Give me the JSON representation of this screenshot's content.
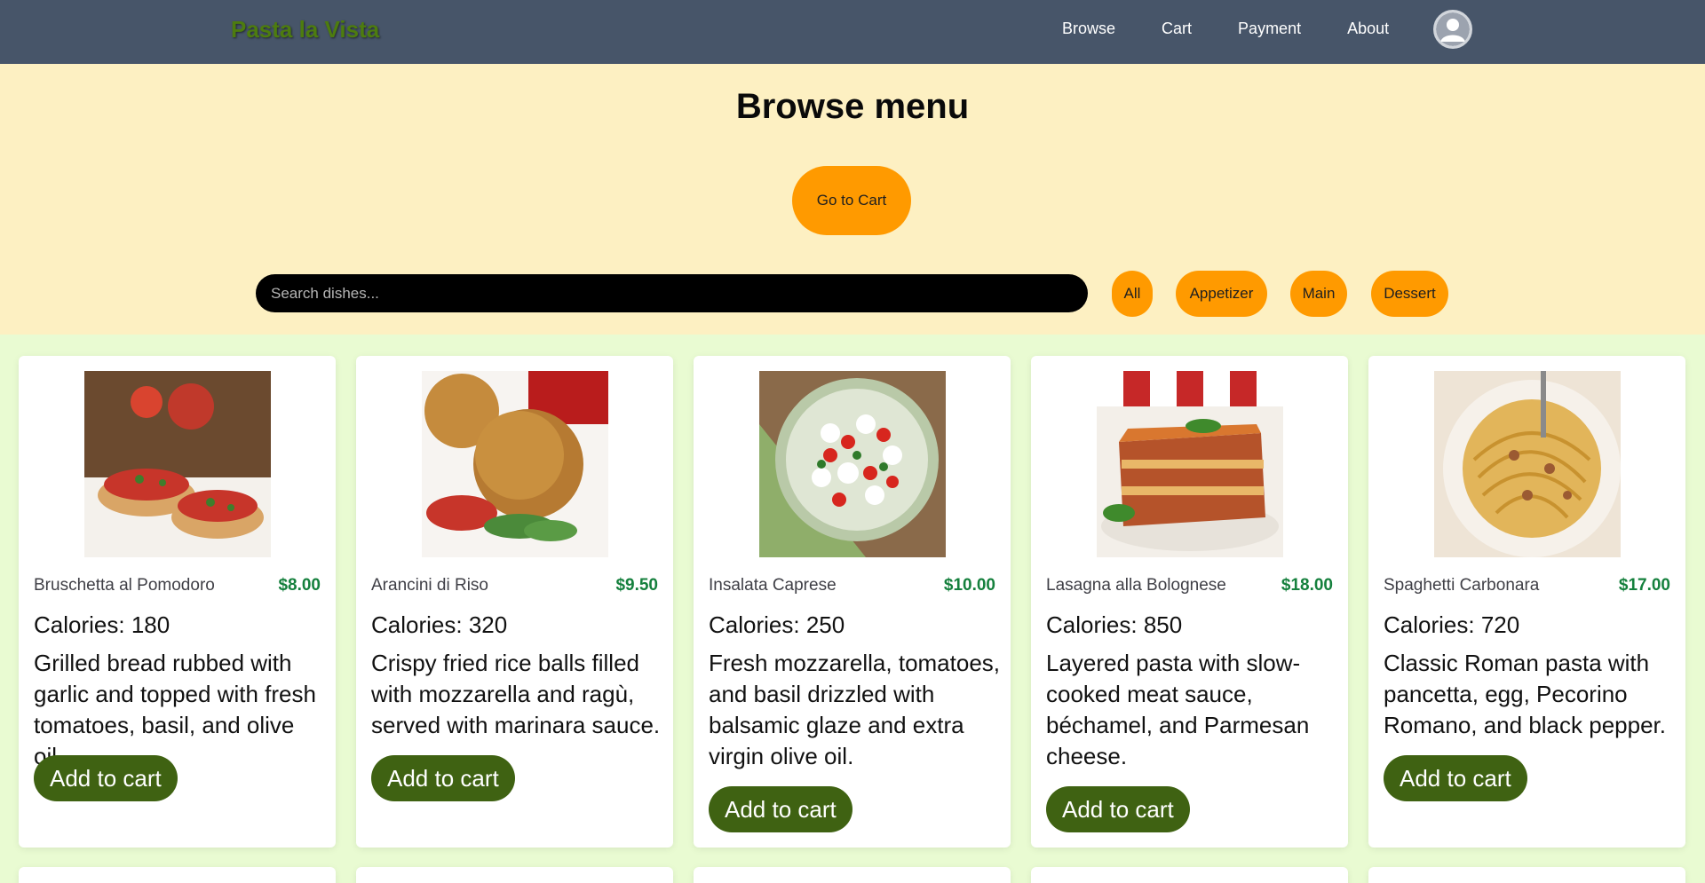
{
  "nav": {
    "brand": "Pasta la Vista",
    "links": [
      "Browse",
      "Cart",
      "Payment",
      "About"
    ],
    "avatar_icon": "user-avatar-icon"
  },
  "hero": {
    "title": "Browse menu",
    "go_cart_label": "Go to Cart",
    "search_placeholder": "Search dishes...",
    "search_value": "",
    "filters": [
      "All",
      "Appetizer",
      "Main",
      "Dessert"
    ]
  },
  "colors": {
    "navbar": "#475569",
    "brand": "#4d7c0f",
    "hero_bg": "#fdf0c2",
    "page_bg": "#e9fbd2",
    "accent_orange": "#ff9a00",
    "price_green": "#15803d",
    "button_green": "#3f6212"
  },
  "dishes": [
    {
      "name": "Bruschetta al Pomodoro",
      "price": "$8.00",
      "calories": "Calories: 180",
      "description": "Grilled bread rubbed with garlic and topped with fresh tomatoes, basil, and olive oil.",
      "add_label": "Add to cart",
      "image": "bruschetta-photo"
    },
    {
      "name": "Arancini di Riso",
      "price": "$9.50",
      "calories": "Calories: 320",
      "description": "Crispy fried rice balls filled with mozzarella and ragù, served with marinara sauce.",
      "add_label": "Add to cart",
      "image": "arancini-photo"
    },
    {
      "name": "Insalata Caprese",
      "price": "$10.00",
      "calories": "Calories: 250",
      "description": "Fresh mozzarella, tomatoes, and basil drizzled with balsamic glaze and extra virgin olive oil.",
      "add_label": "Add to cart",
      "image": "caprese-photo"
    },
    {
      "name": "Lasagna alla Bolognese",
      "price": "$18.00",
      "calories": "Calories: 850",
      "description": "Layered pasta with slow-cooked meat sauce, béchamel, and Parmesan cheese.",
      "add_label": "Add to cart",
      "image": "lasagna-photo"
    },
    {
      "name": "Spaghetti Carbonara",
      "price": "$17.00",
      "calories": "Calories: 720",
      "description": "Classic Roman pasta with pancetta, egg, Pecorino Romano, and black pepper.",
      "add_label": "Add to cart",
      "image": "carbonara-photo"
    }
  ]
}
